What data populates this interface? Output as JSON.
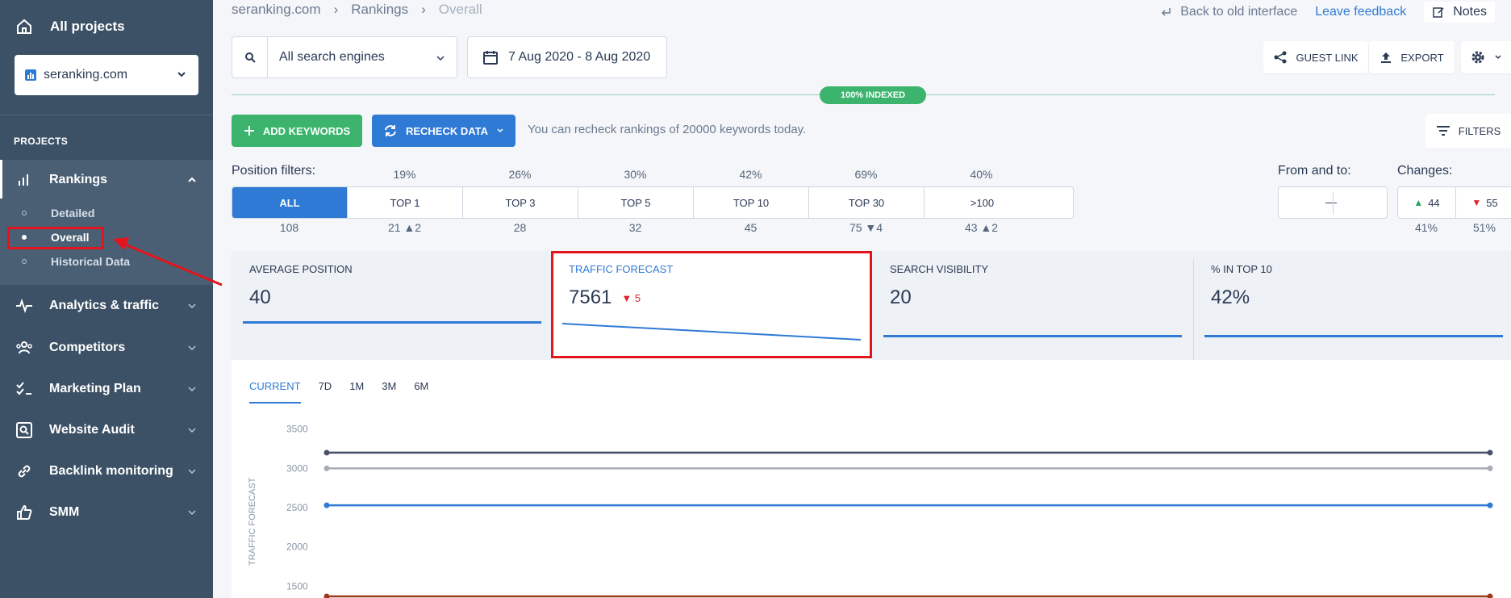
{
  "sidebar": {
    "all_projects": "All projects",
    "project": "seranking.com",
    "projects_label": "PROJECTS",
    "rankings": "Rankings",
    "sub_items": [
      "Detailed",
      "Overall",
      "Historical Data"
    ],
    "items": [
      "Analytics & traffic",
      "Competitors",
      "Marketing Plan",
      "Website Audit",
      "Backlink monitoring",
      "SMM"
    ]
  },
  "header": {
    "breadcrumbs": [
      "seranking.com",
      "Rankings",
      "Overall"
    ],
    "back_link": "Back to old interface",
    "feedback": "Leave feedback",
    "notes": "Notes"
  },
  "toolbar": {
    "engine": "All search engines",
    "date_range": "7 Aug 2020 - 8 Aug 2020",
    "guest_link": "GUEST LINK",
    "export": "EXPORT",
    "indexed": "100% INDEXED",
    "add_keywords": "ADD KEYWORDS",
    "recheck": "RECHECK DATA",
    "recheck_note": "You can recheck rankings of 20000 keywords today.",
    "filters": "FILTERS"
  },
  "position_filters": {
    "label": "Position filters:",
    "percents": [
      "19%",
      "26%",
      "30%",
      "42%",
      "69%",
      "40%"
    ],
    "buttons": [
      "ALL",
      "TOP 1",
      "TOP 3",
      "TOP 5",
      "TOP 10",
      "TOP 30",
      ">100"
    ],
    "counts": [
      "108",
      "21",
      "28",
      "32",
      "45",
      "75",
      "43"
    ],
    "count_changes": [
      "",
      "2",
      "",
      "",
      "",
      "4",
      "2"
    ],
    "from_to_label": "From and to:",
    "from_to_value": "—",
    "changes_label": "Changes:",
    "changes_up": "44",
    "changes_down": "55",
    "changes_up_pct": "41%",
    "changes_down_pct": "51%"
  },
  "metrics": [
    {
      "label": "AVERAGE POSITION",
      "value": "40",
      "change": ""
    },
    {
      "label": "TRAFFIC FORECAST",
      "value": "7561",
      "change": "5"
    },
    {
      "label": "SEARCH VISIBILITY",
      "value": "20",
      "change": ""
    },
    {
      "label": "% IN TOP 10",
      "value": "42%",
      "change": ""
    }
  ],
  "chart": {
    "tabs": [
      "CURRENT",
      "7D",
      "1M",
      "3M",
      "6M"
    ],
    "ylabel": "TRAFFIC FORECAST"
  },
  "chart_data": {
    "type": "line",
    "x": [
      "start",
      "end"
    ],
    "ylim": [
      1350,
      3600
    ],
    "yticks": [
      3500,
      3000,
      2500,
      2000,
      1500
    ],
    "grid": false,
    "series": [
      {
        "color": "#4a5068",
        "values": [
          3200,
          3200
        ]
      },
      {
        "color": "#a8adb3",
        "values": [
          3000,
          3000
        ]
      },
      {
        "color": "#2f7ad5",
        "values": [
          2530,
          2530
        ]
      },
      {
        "color": "#9a3a1a",
        "values": [
          1370,
          1370
        ]
      }
    ]
  }
}
